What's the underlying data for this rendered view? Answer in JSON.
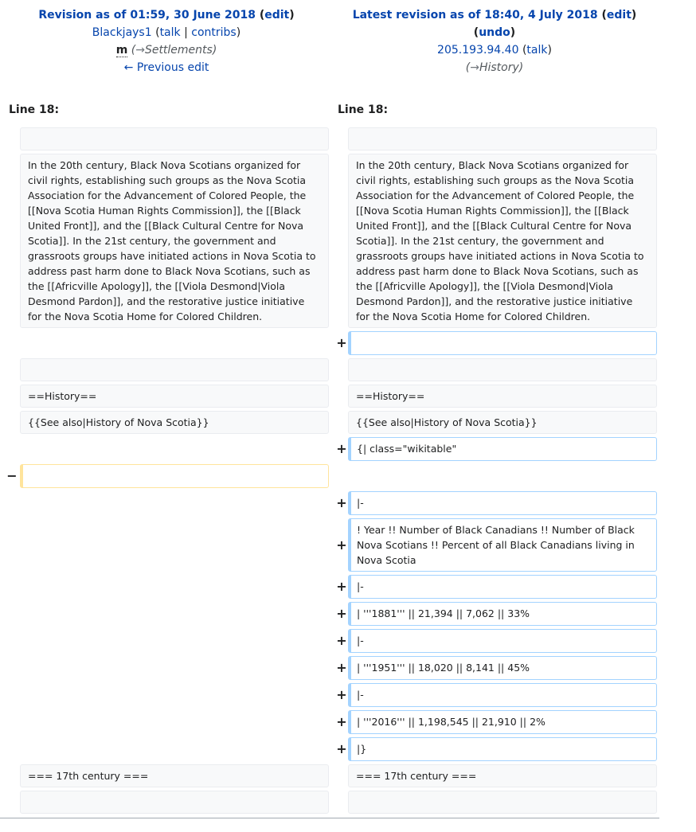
{
  "left_header": {
    "title_prefix": "Revision as of 01:59, 30 June 2018",
    "edit": "edit",
    "user": "Blackjays1",
    "talk": "talk",
    "sep": "|",
    "contribs": "contribs",
    "minor": "m",
    "summary_arrow": "→",
    "summary_section": "Settlements",
    "prev_edit": "← Previous edit"
  },
  "right_header": {
    "title_prefix": "Latest revision as of 18:40, 4 July 2018",
    "edit": "edit",
    "undo": "undo",
    "user": "205.193.94.40",
    "talk": "talk",
    "summary_arrow": "→",
    "summary_section": "History"
  },
  "line_no": {
    "left": "Line 18:",
    "right": "Line 18:"
  },
  "markers": {
    "plus": "+",
    "minus": "−"
  },
  "rows": {
    "empty": "",
    "para": "In the 20th century, Black Nova Scotians organized for civil rights, establishing such groups as the Nova Scotia Association for the Advancement of Colored People, the [[Nova Scotia Human Rights Commission]], the [[Black United Front]], and the [[Black Cultural Centre for Nova Scotia]]. In the 21st century, the government and grassroots groups have initiated actions in Nova Scotia to address past harm done to Black Nova Scotians, such as the [[Africville Apology]], the [[Viola Desmond|Viola Desmond Pardon]], and the restorative justice initiative for the Nova Scotia Home for Colored Children.",
    "history": "==History==",
    "see_also": "{{See also|History of Nova Scotia}}",
    "table_start": "{| class=\"wikitable\"",
    "row_sep": "|-",
    "table_header": "! Year !! Number of Black Canadians !! Number of Black Nova Scotians !! Percent of all Black Canadians living in Nova Scotia",
    "row_1881": "| '''1881''' || 21,394 || 7,062 || 33%",
    "row_1951": "| '''1951''' || 18,020 || 8,141 || 45%",
    "row_2016": "| '''2016''' || 1,198,545 || 21,910 || 2%",
    "table_end": "|}",
    "century": "=== 17th century ==="
  }
}
